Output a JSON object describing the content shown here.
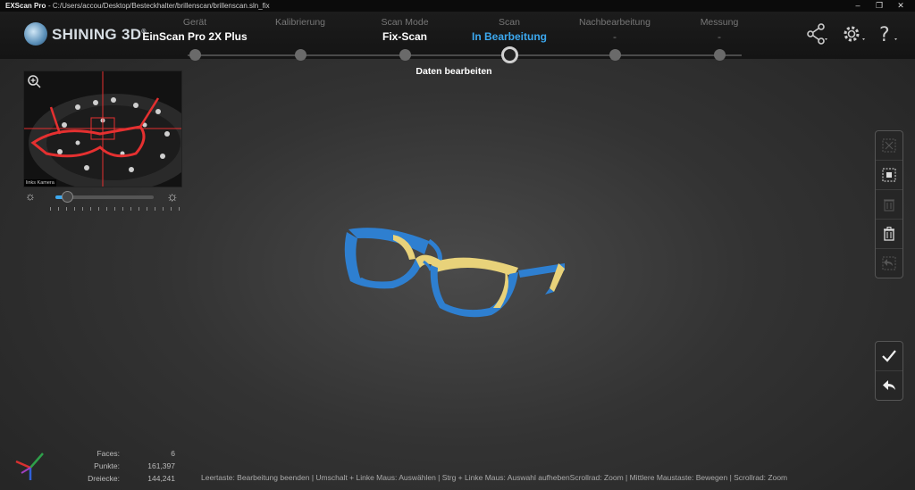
{
  "titlebar": {
    "app_name": "EXScan Pro",
    "path": "-  C:/Users/accou/Desktop/Besteckhalter/brillenscan/brillenscan.sln_fix"
  },
  "brand": {
    "name": "SHINING 3D",
    "mark": "®"
  },
  "steps": [
    {
      "label": "Gerät",
      "value": "EinScan Pro 2X Plus",
      "state": "done"
    },
    {
      "label": "Kalibrierung",
      "value": "",
      "state": "done"
    },
    {
      "label": "Scan Mode",
      "value": "Fix-Scan",
      "state": "done"
    },
    {
      "label": "Scan",
      "value": "In Bearbeitung",
      "state": "active"
    },
    {
      "label": "Nachbearbeitung",
      "value": "-",
      "state": "pending"
    },
    {
      "label": "Messung",
      "value": "-",
      "state": "pending"
    }
  ],
  "active_sublabel": "Daten bearbeiten",
  "preview": {
    "camera_label": "links Kamera"
  },
  "brightness": {
    "level": 0.12
  },
  "stats": [
    {
      "key": "Faces:",
      "value": "6"
    },
    {
      "key": "Punkte:",
      "value": "161,397"
    },
    {
      "key": "Dreiecke:",
      "value": "144,241"
    }
  ],
  "hint": "Leertaste: Bearbeitung beenden | Umschalt + Linke Maus: Auswählen | Strg + Linke Maus: Auswahl aufhebenScrollrad: Zoom | Mittlere Maustaste: Bewegen | Scrollrad: Zoom",
  "colors": {
    "accent": "#3ca8ef",
    "model_blue": "#2e7fd0",
    "model_yellow": "#e8d27a"
  }
}
